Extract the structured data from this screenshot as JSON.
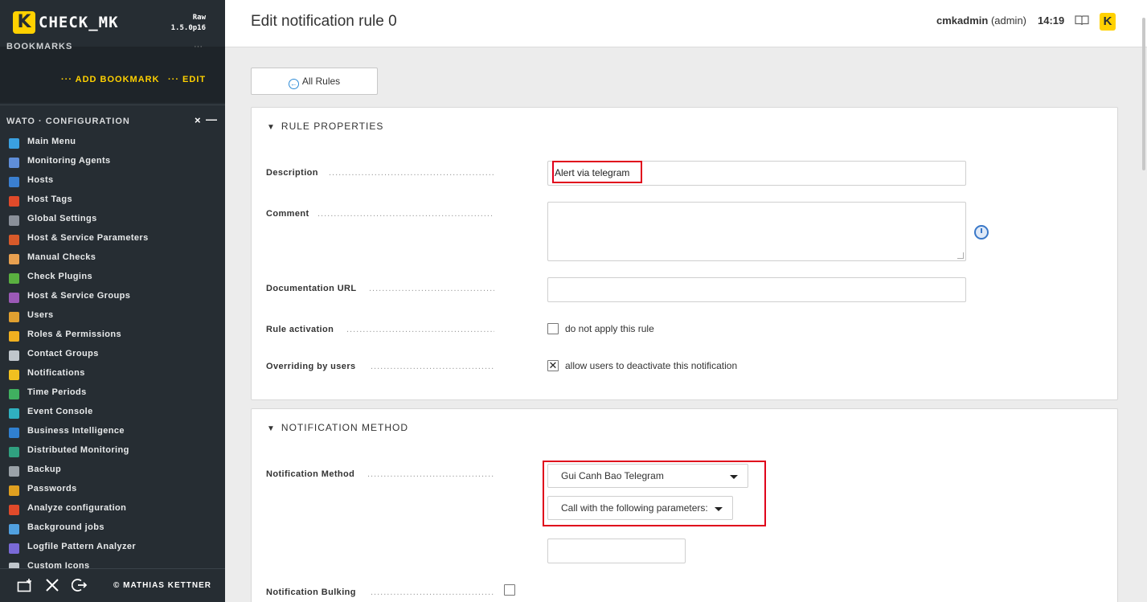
{
  "app": {
    "logo_letter": "K",
    "name": "CHECK_MK",
    "edition_line1": "Raw",
    "edition_line2": "1.5.0p16"
  },
  "bookmarks": {
    "title": "BOOKMARKS",
    "dots": "···",
    "add_label": "··· ADD BOOKMARK",
    "edit_label": "··· EDIT"
  },
  "wato": {
    "title": "WATO · CONFIGURATION",
    "close_glyph": "×",
    "min_glyph": "—"
  },
  "sidebar": {
    "items": [
      {
        "label": "Main Menu",
        "icon": "home-icon",
        "color": "#3aa0e0"
      },
      {
        "label": "Monitoring Agents",
        "icon": "agent-icon",
        "color": "#5f8ed8"
      },
      {
        "label": "Hosts",
        "icon": "host-icon",
        "color": "#3a7fd0"
      },
      {
        "label": "Host Tags",
        "icon": "tag-icon",
        "color": "#e04a2a"
      },
      {
        "label": "Global Settings",
        "icon": "gear-icon",
        "color": "#8a9099"
      },
      {
        "label": "Host & Service Parameters",
        "icon": "rules-icon",
        "color": "#d85a2a"
      },
      {
        "label": "Manual Checks",
        "icon": "hand-icon",
        "color": "#e8a050"
      },
      {
        "label": "Check Plugins",
        "icon": "puzzle-icon",
        "color": "#5ab040"
      },
      {
        "label": "Host & Service Groups",
        "icon": "groups-icon",
        "color": "#9b59b6"
      },
      {
        "label": "Users",
        "icon": "users-icon",
        "color": "#e0a030"
      },
      {
        "label": "Roles & Permissions",
        "icon": "roles-icon",
        "color": "#f0b020"
      },
      {
        "label": "Contact Groups",
        "icon": "contact-icon",
        "color": "#c0c6cc"
      },
      {
        "label": "Notifications",
        "icon": "bell-icon",
        "color": "#f0c020"
      },
      {
        "label": "Time Periods",
        "icon": "clock-icon",
        "color": "#40b060"
      },
      {
        "label": "Event Console",
        "icon": "event-icon",
        "color": "#30b0c0"
      },
      {
        "label": "Business Intelligence",
        "icon": "bi-icon",
        "color": "#3080d0"
      },
      {
        "label": "Distributed Monitoring",
        "icon": "globe-icon",
        "color": "#30a080"
      },
      {
        "label": "Backup",
        "icon": "backup-icon",
        "color": "#9aa2a8"
      },
      {
        "label": "Passwords",
        "icon": "key-icon",
        "color": "#e0a020"
      },
      {
        "label": "Analyze configuration",
        "icon": "heart-check-icon",
        "color": "#e04a2a"
      },
      {
        "label": "Background jobs",
        "icon": "list-icon",
        "color": "#50a0e0"
      },
      {
        "label": "Logfile Pattern Analyzer",
        "icon": "flask-icon",
        "color": "#7a6ad8"
      },
      {
        "label": "Custom Icons",
        "icon": "custom-icon",
        "color": "#c0c6cc"
      }
    ],
    "copyright": "© MATHIAS KETTNER"
  },
  "header": {
    "title": "Edit notification rule 0",
    "user": "cmkadmin",
    "role": "(admin)",
    "time": "14:19",
    "book_glyph": "📖",
    "logo_letter": "K"
  },
  "main": {
    "all_rules_label": "All Rules",
    "rule_properties": {
      "title": "RULE PROPERTIES",
      "description_label": "Description",
      "description_value": "Alert via telegram",
      "comment_label": "Comment",
      "doc_url_label": "Documentation URL",
      "activation_label": "Rule activation",
      "activation_checkbox_label": "do not apply this rule",
      "overriding_label": "Overriding by users",
      "overriding_checkbox_label": "allow users to deactivate this notification",
      "overriding_checked_glyph": "✕"
    },
    "notification_method": {
      "title": "NOTIFICATION METHOD",
      "method_label": "Notification Method",
      "method_selected": "Gui Canh Bao Telegram",
      "params_selected": "Call with the following parameters:",
      "bulking_label": "Notification Bulking"
    }
  },
  "colors": {
    "sidebar_bg": "#262d33",
    "brand_yellow": "#ffd100",
    "highlight_red": "#e0001b",
    "link_blue": "#2e8bd6"
  }
}
